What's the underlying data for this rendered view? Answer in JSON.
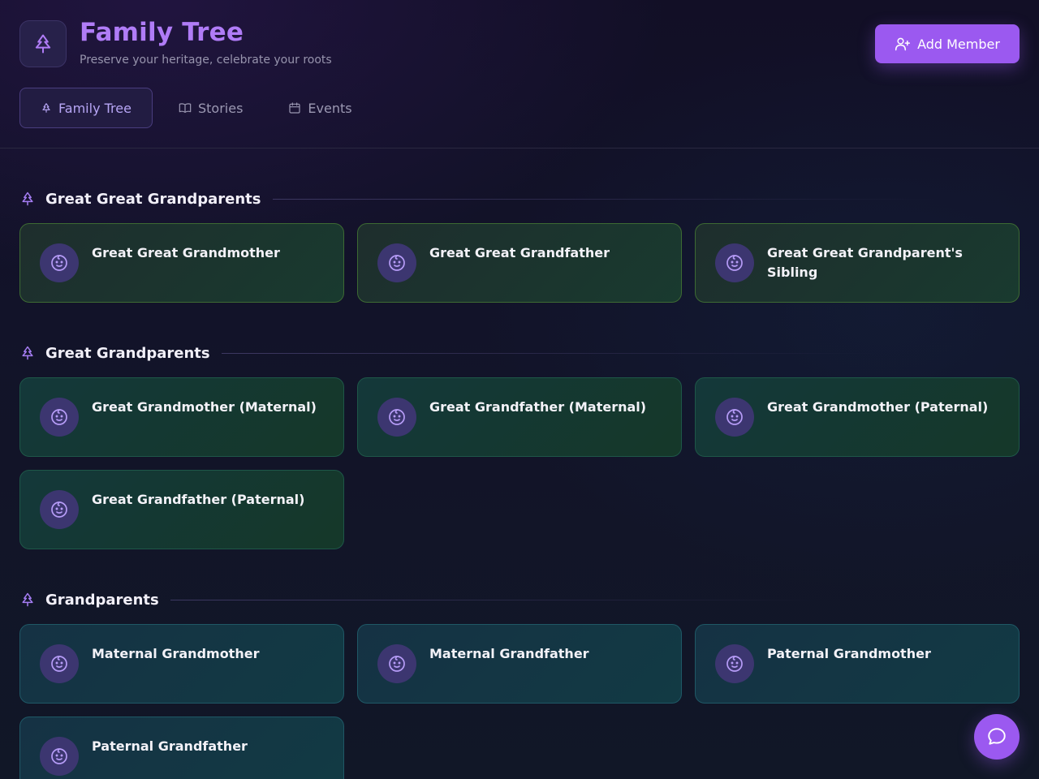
{
  "header": {
    "title": "Family Tree",
    "subtitle": "Preserve your heritage, celebrate your roots",
    "logo_icon": "tree-icon",
    "add_button": {
      "label": "Add Member",
      "icon": "user-plus-icon"
    }
  },
  "tabs": [
    {
      "label": "Family Tree",
      "icon": "tree-icon",
      "active": true
    },
    {
      "label": "Stories",
      "icon": "book-icon",
      "active": false
    },
    {
      "label": "Events",
      "icon": "calendar-icon",
      "active": false
    }
  ],
  "sections": [
    {
      "title": "Great Great Grandparents",
      "members": [
        "Great Great Grandmother",
        "Great Great Grandfather",
        "Great Great Grandparent's Sibling"
      ]
    },
    {
      "title": "Great Grandparents",
      "members": [
        "Great Grandmother (Maternal)",
        "Great Grandfather (Maternal)",
        "Great Grandmother (Paternal)",
        "Great Grandfather (Paternal)"
      ]
    },
    {
      "title": "Grandparents",
      "members": [
        "Maternal Grandmother",
        "Maternal Grandfather",
        "Paternal Grandmother",
        "Paternal Grandfather"
      ]
    }
  ],
  "chat_button": {
    "icon": "chat-bubble-icon"
  },
  "colors": {
    "accent": "#9b59f0",
    "title": "#b07cf7",
    "background": "#121329"
  }
}
